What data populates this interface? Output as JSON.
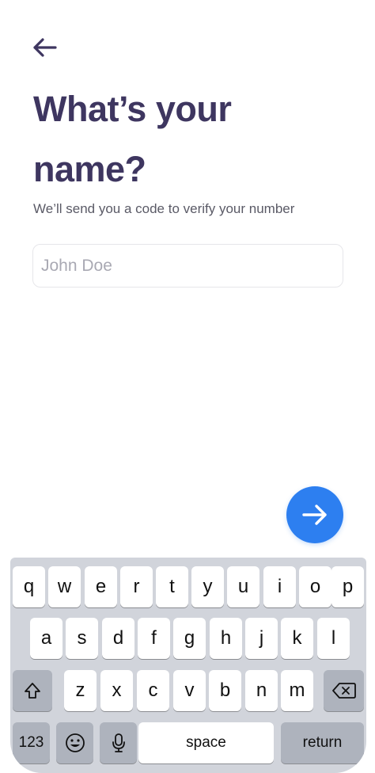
{
  "header": {
    "back_icon": "arrow-left-icon"
  },
  "title": "What’s your name?",
  "subtitle": "We’ll send you a code to verify your number",
  "name_field": {
    "value": "",
    "placeholder": "John Doe"
  },
  "next_button": {
    "icon": "arrow-right-icon",
    "color": "#2d7ff0"
  },
  "colors": {
    "title": "#3e3660",
    "accent": "#2d7ff0",
    "keyboard_bg": "#d1d4db"
  },
  "keyboard": {
    "row1": [
      "q",
      "w",
      "e",
      "r",
      "t",
      "y",
      "u",
      "i",
      "o",
      "p"
    ],
    "row2": [
      "a",
      "s",
      "d",
      "f",
      "g",
      "h",
      "j",
      "k",
      "l"
    ],
    "row3": [
      "z",
      "x",
      "c",
      "v",
      "b",
      "n",
      "m"
    ],
    "numbers_label": "123",
    "space_label": "space",
    "return_label": "return",
    "shift_icon": "shift-icon",
    "delete_icon": "backspace-icon",
    "emoji_icon": "emoji-icon",
    "mic_icon": "microphone-icon"
  }
}
